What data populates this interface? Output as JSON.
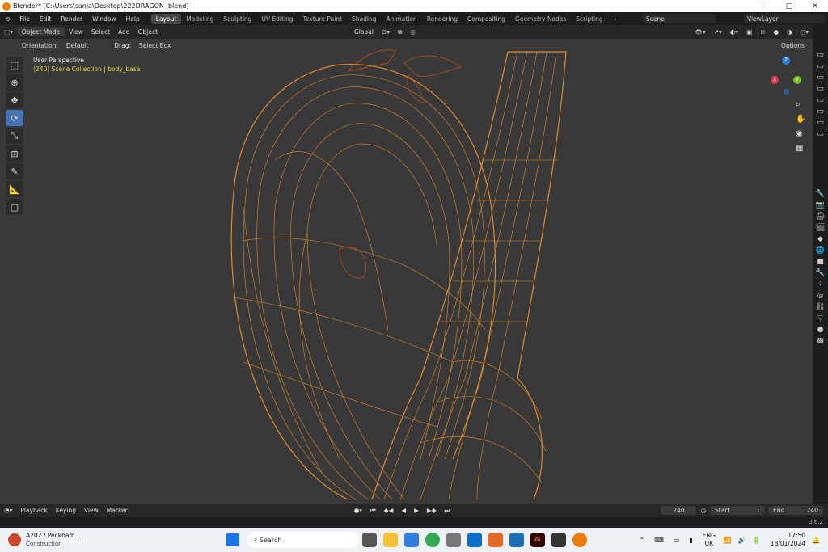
{
  "window": {
    "title": "Blender* [C:\\Users\\sanja\\Desktop\\222DRAGON .blend]",
    "min": "–",
    "max": "□",
    "close": "✕"
  },
  "menu": [
    "File",
    "Edit",
    "Render",
    "Window",
    "Help"
  ],
  "workspaces": [
    "Layout",
    "Modeling",
    "Sculpting",
    "UV Editing",
    "Texture Paint",
    "Shading",
    "Animation",
    "Rendering",
    "Compositing",
    "Geometry Nodes",
    "Scripting",
    "+"
  ],
  "scene": {
    "name": "Scene",
    "view_layer": "ViewLayer"
  },
  "header": {
    "mode": "Object Mode",
    "view": "View",
    "select": "Select",
    "add": "Add",
    "object": "Object",
    "transform": "Global",
    "options": "Options"
  },
  "tool_settings": {
    "orientation_label": "Orientation:",
    "orientation_value": "Default",
    "drag_label": "Drag:",
    "drag_value": "Select Box"
  },
  "viewport": {
    "perspective": "User Perspective",
    "collection": "(240) Scene Collection | body_base",
    "wire_color": "#f7a030",
    "bg_color": "#393939"
  },
  "gizmo": {
    "x": "X",
    "y": "Y",
    "z": "Z"
  },
  "timeline": {
    "playback": "Playback",
    "keying": "Keying",
    "view": "View",
    "marker": "Marker",
    "current_frame": "240",
    "start_label": "Start",
    "start": "1",
    "end_label": "End",
    "end": "240"
  },
  "status": {
    "version": "3.6.2"
  },
  "taskbar": {
    "notification": "A202 / Peckham...",
    "notification_sub": "Construction",
    "search": "Search",
    "lang": "ENG",
    "region": "UK",
    "time": "17:50",
    "date": "18/01/2024"
  }
}
